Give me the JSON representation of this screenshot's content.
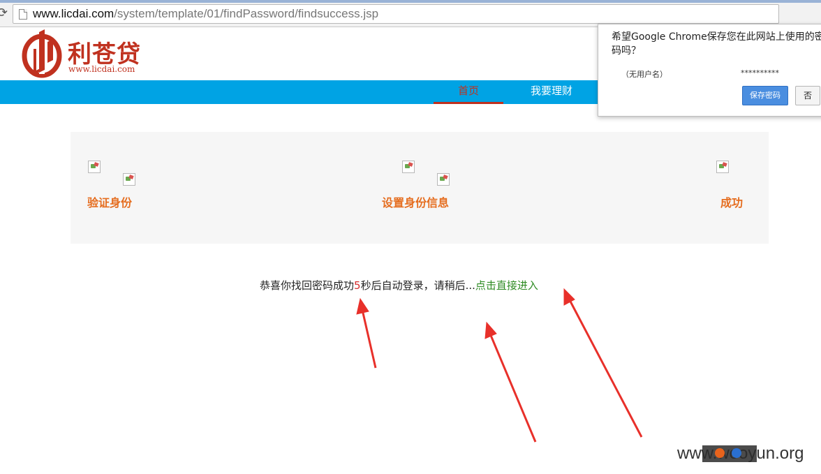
{
  "browser": {
    "url_host": "www.licdai.com",
    "url_path": "/system/template/01/findPassword/findsuccess.jsp"
  },
  "site": {
    "logo_name": "利苍贷",
    "logo_url": "www.licdai.com",
    "nav": [
      {
        "label": "首页",
        "active": true
      },
      {
        "label": "我要理财",
        "active": false
      }
    ],
    "brand_color": "#c0311f",
    "nav_color": "#00a3e4"
  },
  "steps": [
    {
      "label": "验证身份"
    },
    {
      "label": "设置身份信息"
    },
    {
      "label": "成功"
    }
  ],
  "message": {
    "prefix": "恭喜你找回密码成功",
    "countdown": "5",
    "suffix": "秒后自动登录，请稍后...",
    "link": "点击直接进入"
  },
  "password_bubble": {
    "title": "希望Google Chrome保存您在此网站上使用的密码吗？",
    "username": "（无用户名）",
    "password": "**********",
    "save_button": "保存密码",
    "no_button": "否"
  },
  "watermark": {
    "text": "www.wooyun.org"
  }
}
